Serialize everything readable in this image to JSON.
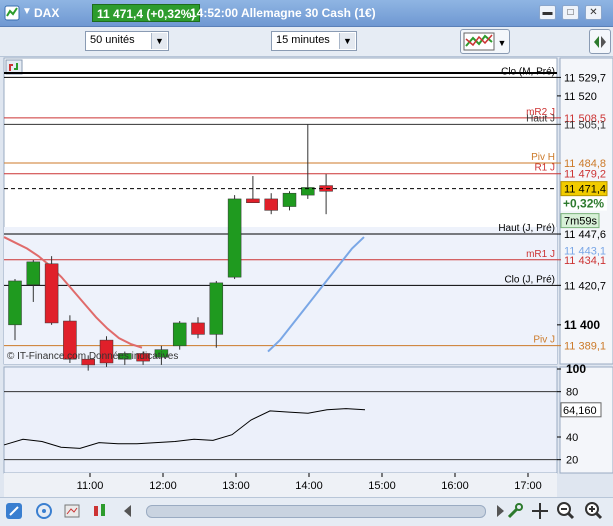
{
  "titlebar": {
    "symbol": "DAX",
    "price_change": "11 471,4 (+0,32%)",
    "time": "14:52:00",
    "instrument": "Allemagne 30 Cash (1€)"
  },
  "toolbar": {
    "units_select": "50 unités",
    "interval_select": "15 minutes"
  },
  "chart": {
    "levels": [
      {
        "label": "Clo (M, Pré)",
        "price": "11 529,7",
        "color": "#000000"
      },
      {
        "label": "mR2 J",
        "price": "11 508,5",
        "color": "#cc3333"
      },
      {
        "label": "Haut J",
        "price": "11 505,1",
        "color": "#333333"
      },
      {
        "label": "Piv H",
        "price": "11 484,8",
        "color": "#cc7a29"
      },
      {
        "label": "R1 J",
        "price": "11 479,2",
        "color": "#cc3333"
      },
      {
        "label": "Haut (J, Pré)",
        "price": "11 447,6",
        "color": "#000000"
      },
      {
        "label": "mR1 J",
        "price": "11 434,1",
        "color": "#cc3333"
      },
      {
        "label": "Clo (J, Pré)",
        "price": "11 420,7",
        "color": "#000000"
      },
      {
        "label": "Piv J",
        "price": "11 389,1",
        "color": "#cc7a29"
      }
    ],
    "axis_ticks": [
      "11 520",
      "11 400"
    ],
    "current_price": "11 471,4",
    "change": "+0,32%",
    "countdown": "7m59s",
    "ma_value": "11 443,1",
    "watermark": "© IT-Finance.com  Données indicatives",
    "time_labels": [
      "11:00",
      "12:00",
      "13:00",
      "14:00",
      "15:00",
      "16:00",
      "17:00"
    ],
    "indicator_ticks": [
      "100",
      "80",
      "40",
      "20"
    ],
    "indicator_value": "64,160"
  },
  "chart_data": {
    "type": "candlestick",
    "candles": [
      {
        "o": 11400,
        "h": 11424,
        "l": 11392,
        "c": 11423
      },
      {
        "o": 11421,
        "h": 11434,
        "l": 11412,
        "c": 11433
      },
      {
        "o": 11432,
        "h": 11436,
        "l": 11400,
        "c": 11401
      },
      {
        "o": 11402,
        "h": 11405,
        "l": 11380,
        "c": 11382
      },
      {
        "o": 11382,
        "h": 11384,
        "l": 11376,
        "c": 11379
      },
      {
        "o": 11392,
        "h": 11394,
        "l": 11378,
        "c": 11380
      },
      {
        "o": 11382,
        "h": 11386,
        "l": 11379,
        "c": 11385
      },
      {
        "o": 11385,
        "h": 11386,
        "l": 11379,
        "c": 11381
      },
      {
        "o": 11383,
        "h": 11389,
        "l": 11379,
        "c": 11387
      },
      {
        "o": 11389,
        "h": 11402,
        "l": 11387,
        "c": 11401
      },
      {
        "o": 11401,
        "h": 11404,
        "l": 11393,
        "c": 11395
      },
      {
        "o": 11395,
        "h": 11423,
        "l": 11388,
        "c": 11422
      },
      {
        "o": 11425,
        "h": 11468,
        "l": 11424,
        "c": 11466
      },
      {
        "o": 11466,
        "h": 11478,
        "l": 11464,
        "c": 11464
      },
      {
        "o": 11466,
        "h": 11469,
        "l": 11458,
        "c": 11460
      },
      {
        "o": 11462,
        "h": 11470,
        "l": 11460,
        "c": 11469
      },
      {
        "o": 11468,
        "h": 11505,
        "l": 11466,
        "c": 11472
      },
      {
        "o": 11473,
        "h": 11479,
        "l": 11458,
        "c": 11470
      }
    ],
    "moving_average_1": [
      11446,
      11443,
      11440,
      11436,
      11431,
      11425,
      11418,
      11411,
      11404,
      11398,
      11393,
      11390,
      11388
    ],
    "moving_average_2": [
      11386,
      11392,
      11400,
      11408,
      11416,
      11424,
      11432,
      11440,
      11446
    ],
    "indicator": [
      33,
      38,
      36,
      31,
      30,
      35,
      34,
      34,
      35,
      36,
      38,
      37,
      42,
      55,
      63,
      62,
      61,
      64,
      65,
      64
    ],
    "ylim": [
      11380,
      11532
    ],
    "indicator_ylim": [
      10,
      100
    ]
  }
}
